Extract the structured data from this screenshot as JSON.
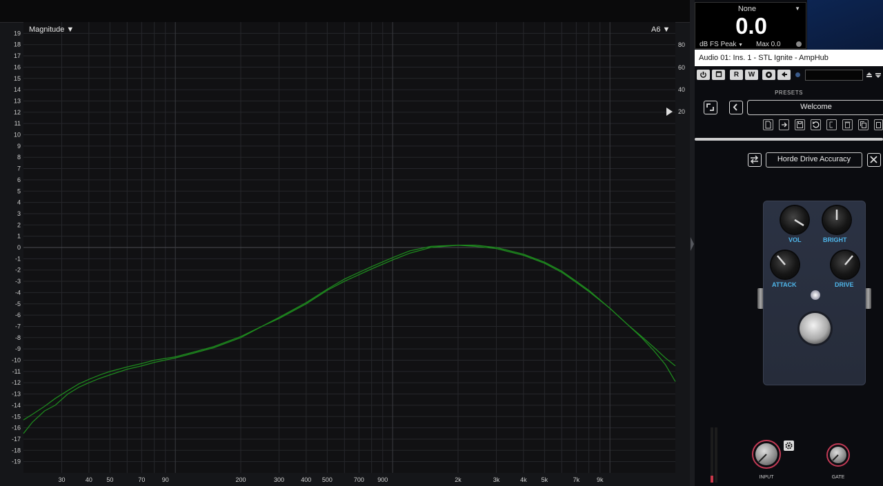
{
  "analyzer": {
    "magnitude_label": "Magnitude ▼",
    "note_label": "A6 ▼",
    "right_scale": [
      "80",
      "60",
      "40",
      "20"
    ]
  },
  "chart_data": {
    "type": "line",
    "xlabel": "",
    "ylabel": "",
    "x_scale": "log",
    "xlim": [
      20,
      20000
    ],
    "ylim": [
      -20,
      20
    ],
    "grid": true,
    "x_tick_labels": [
      "30",
      "40",
      "50",
      "70",
      "90",
      "200",
      "300",
      "400",
      "500",
      "700",
      "900",
      "2k",
      "3k",
      "4k",
      "5k",
      "7k",
      "9k"
    ],
    "y_tick_labels": [
      "19",
      "18",
      "17",
      "16",
      "15",
      "14",
      "13",
      "12",
      "11",
      "10",
      "9",
      "8",
      "7",
      "6",
      "5",
      "4",
      "3",
      "2",
      "1",
      "0",
      "-1",
      "-2",
      "-3",
      "-4",
      "-5",
      "-6",
      "-7",
      "-8",
      "-9",
      "-10",
      "-11",
      "-12",
      "-13",
      "-14",
      "-15",
      "-16",
      "-17",
      "-18",
      "-19"
    ],
    "color": "#1e8a1e",
    "series": [
      {
        "x": [
          20,
          22,
          25,
          28,
          32,
          36,
          40,
          45,
          50,
          60,
          70,
          80,
          100,
          120,
          150,
          200,
          250,
          300,
          400,
          500,
          600,
          800,
          1000,
          1200,
          1500,
          2000,
          2400,
          3000,
          4000,
          5000,
          6000,
          7000,
          8000,
          10000,
          12000,
          14000,
          16000,
          18000,
          20000
        ],
        "y": [
          -16.5,
          -15.5,
          -14.5,
          -14,
          -13,
          -12.4,
          -12,
          -11.6,
          -11.3,
          -10.8,
          -10.5,
          -10.2,
          -9.8,
          -9.4,
          -8.9,
          -8,
          -7,
          -6.3,
          -5,
          -3.8,
          -3,
          -1.9,
          -1.1,
          -0.5,
          0,
          0.2,
          0.2,
          0,
          -0.6,
          -1.3,
          -2.1,
          -3,
          -3.8,
          -5.4,
          -6.8,
          -8,
          -9.2,
          -10.4,
          -11.9
        ]
      },
      {
        "x": [
          20,
          22,
          25,
          28,
          32,
          36,
          40,
          45,
          50,
          60,
          70,
          80,
          100,
          120,
          150,
          200,
          250,
          300,
          400,
          500,
          600,
          800,
          1000,
          1200,
          1500,
          2000,
          2400,
          3000,
          4000,
          5000,
          6000,
          7000,
          8000,
          10000,
          12000,
          14000,
          16000,
          18000,
          20000
        ],
        "y": [
          -15.3,
          -14.8,
          -14.1,
          -13.4,
          -12.7,
          -12.1,
          -11.7,
          -11.3,
          -11,
          -10.6,
          -10.3,
          -10,
          -9.7,
          -9.3,
          -8.8,
          -7.9,
          -7,
          -6.2,
          -4.9,
          -3.7,
          -2.8,
          -1.7,
          -0.9,
          -0.3,
          0.1,
          0.2,
          0.1,
          -0.1,
          -0.7,
          -1.4,
          -2.2,
          -3.1,
          -3.9,
          -5.4,
          -6.8,
          -7.9,
          -8.9,
          -9.8,
          -10.5
        ]
      }
    ]
  },
  "meter": {
    "source": "None",
    "value": "0.0",
    "unit": "dB FS Peak",
    "max": "Max 0.0"
  },
  "track": {
    "title": "Audio 01: Ins. 1 - STL Ignite - AmpHub"
  },
  "toolbar": {
    "read_label": "R",
    "write_label": "W"
  },
  "presets": {
    "section_label": "PRESETS",
    "current": "Welcome"
  },
  "pedal": {
    "name": "Horde Drive Accuracy",
    "knobs": {
      "vol": "VOL",
      "bright": "BRIGHT",
      "attack": "ATTACK",
      "drive": "DRIVE"
    }
  },
  "bottom": {
    "input_label": "INPUT",
    "gate_label": "GATE"
  }
}
